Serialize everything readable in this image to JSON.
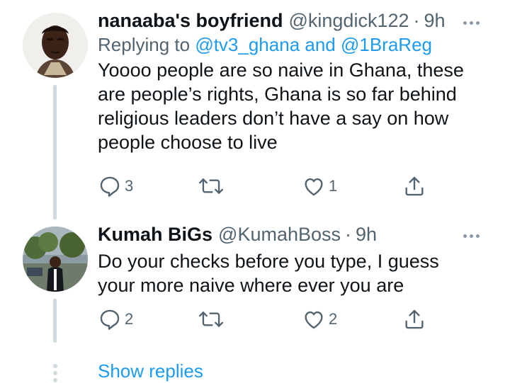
{
  "tweets": [
    {
      "name": "nanaaba's boyfriend",
      "handle": "@kingdick122",
      "separator": "·",
      "time": "9h",
      "replying_prefix": "Replying to",
      "replying_to": "@tv3_ghana and @1BraReg",
      "body_lines": [
        "Yoooo people are so naive in Ghana, these",
        "are people’s rights, Ghana is so far behind",
        "religious leaders don’t have a say on how",
        "people choose to live"
      ],
      "reply_count": "3",
      "retweet_count": "",
      "like_count": "1"
    },
    {
      "name": "Kumah BiGs",
      "handle": "@KumahBoss",
      "separator": "·",
      "time": "9h",
      "body_lines": [
        "Do your checks before you type, I guess",
        "your more naive where ever you are"
      ],
      "reply_count": "2",
      "retweet_count": "",
      "like_count": "2"
    }
  ],
  "show_replies": "Show replies",
  "icons": {
    "reply": "reply-icon",
    "retweet": "retweet-icon",
    "like": "like-icon",
    "share": "share-icon",
    "more": "more-icon"
  },
  "colors": {
    "link": "#1d9bf0",
    "muted": "#536471",
    "thread_line": "#cfd9de"
  }
}
